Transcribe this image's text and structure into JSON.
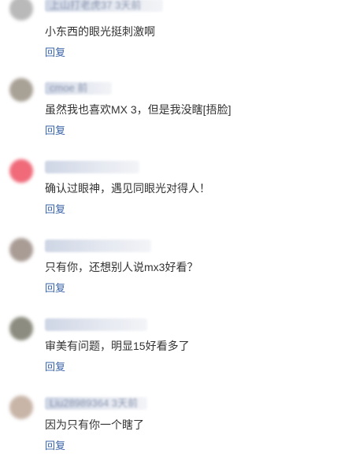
{
  "comments": [
    {
      "meta": "上山打老虎37 3天前",
      "text": "小东西的眼光挺刺激啊",
      "reply_label": "回复",
      "avatar_color": "#b9b9b9"
    },
    {
      "meta": "cmoe 前",
      "text": "虽然我也喜欢MX 3，但是我没瞎[捂脸]",
      "reply_label": "回复",
      "avatar_color": "#a8a196"
    },
    {
      "meta": "",
      "text": "确认过眼神，遇见同眼光对得人！",
      "reply_label": "回复",
      "avatar_color": "#f06a7a"
    },
    {
      "meta": "",
      "text": "只有你，还想别人说mx3好看？",
      "reply_label": "回复",
      "avatar_color": "#a99c95"
    },
    {
      "meta": "",
      "text": "审美有问题，明显15好看多了",
      "reply_label": "回复",
      "avatar_color": "#8c8c80"
    },
    {
      "meta": "Liu28989364 3天前",
      "text": "因为只有你一个瞎了",
      "reply_label": "回复",
      "avatar_color": "#c8b5a8"
    }
  ]
}
